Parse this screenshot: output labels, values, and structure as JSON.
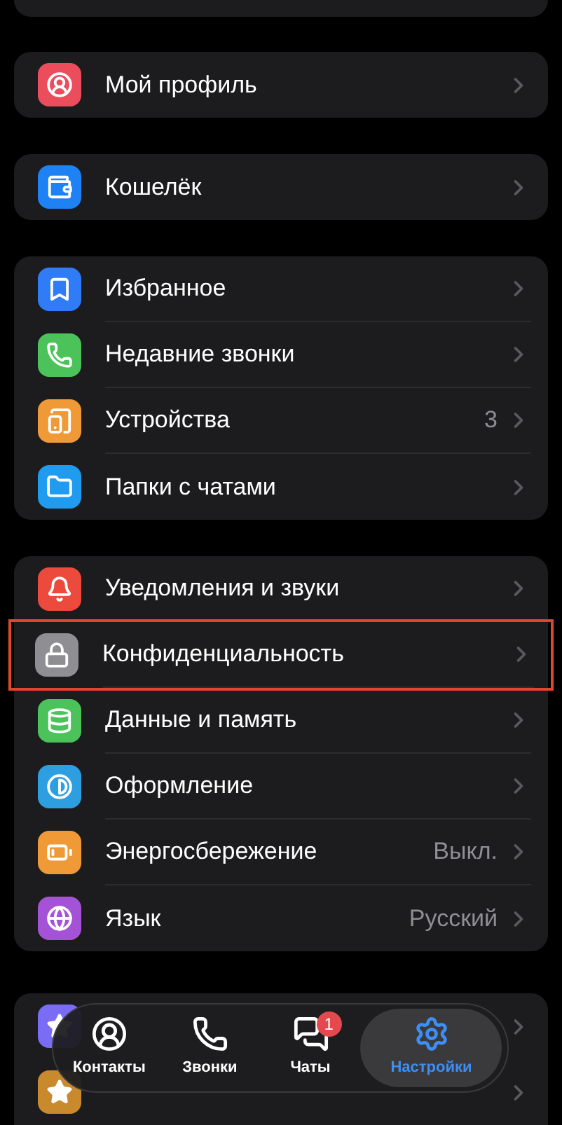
{
  "groups": [
    {
      "items": [
        {
          "label": "Мой профиль",
          "highlighted": false
        }
      ]
    },
    {
      "items": [
        {
          "label": "Кошелёк",
          "highlighted": false
        }
      ]
    },
    {
      "items": [
        {
          "label": "Избранное",
          "highlighted": false
        },
        {
          "label": "Недавние звонки",
          "highlighted": false
        },
        {
          "label": "Устройства",
          "value": "3",
          "highlighted": false
        },
        {
          "label": "Папки с чатами",
          "highlighted": false
        }
      ]
    },
    {
      "items": [
        {
          "label": "Уведомления и звуки",
          "highlighted": false
        },
        {
          "label": "Конфиденциальность",
          "highlighted": true
        },
        {
          "label": "Данные и память",
          "highlighted": false
        },
        {
          "label": "Оформление",
          "highlighted": false
        },
        {
          "label": "Энергосбережение",
          "value": "Выкл.",
          "highlighted": false
        },
        {
          "label": "Язык",
          "value": "Русский",
          "highlighted": false
        }
      ]
    }
  ],
  "tab_bar": [
    {
      "label": "Контакты",
      "selected": false
    },
    {
      "label": "Звонки",
      "selected": false
    },
    {
      "label": "Чаты",
      "badge": "1",
      "selected": false
    },
    {
      "label": "Настройки",
      "selected": true
    }
  ]
}
